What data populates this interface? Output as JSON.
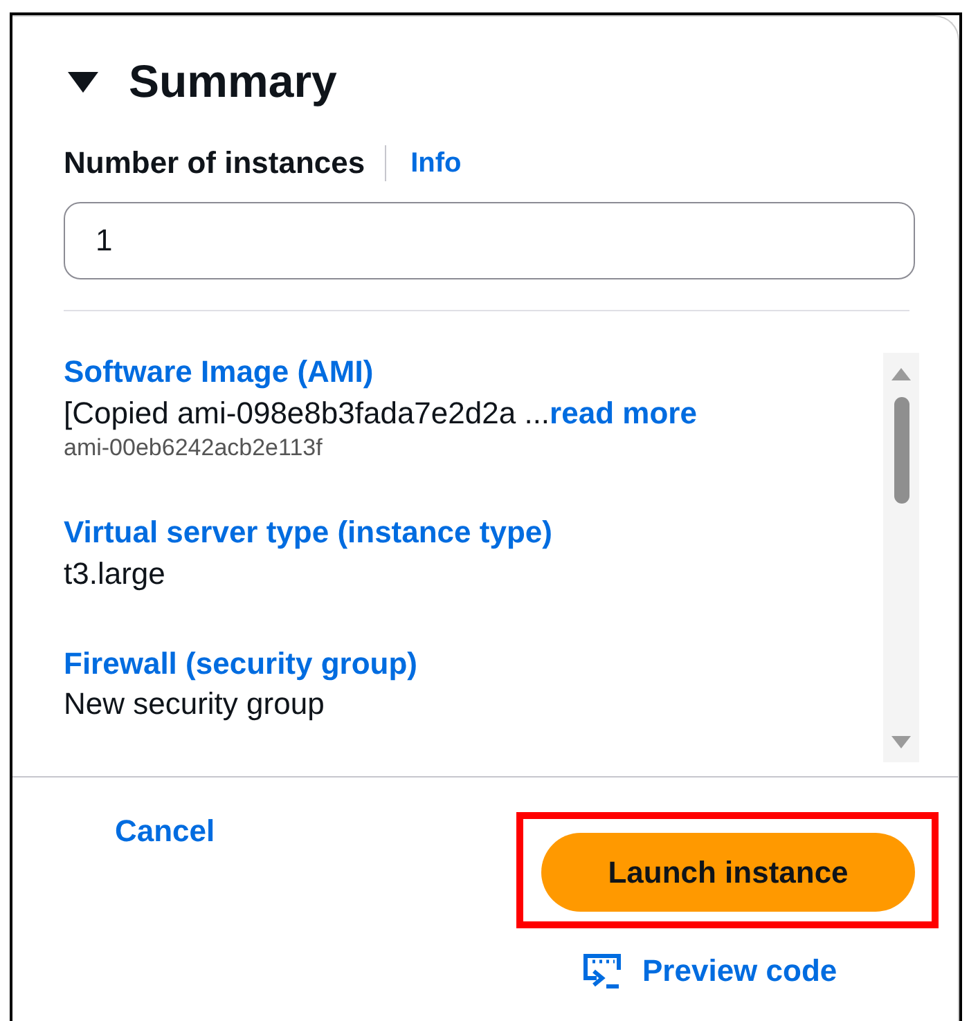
{
  "summary": {
    "title": "Summary",
    "expanded": true
  },
  "instances": {
    "label": "Number of instances",
    "info_link": "Info",
    "value": "1"
  },
  "details": [
    {
      "heading": "Software Image (AMI)",
      "value": "[Copied ami-098e8b3fada7e2d2a ...",
      "value_link": "read more",
      "sub": "ami-00eb6242acb2e113f"
    },
    {
      "heading": "Virtual server type (instance type)",
      "value": "t3.large"
    },
    {
      "heading": "Firewall (security group)",
      "value": "New security group"
    }
  ],
  "footer": {
    "cancel": "Cancel",
    "launch": {
      "label": "Launch instance",
      "highlighted": true
    },
    "preview": "Preview code"
  }
}
